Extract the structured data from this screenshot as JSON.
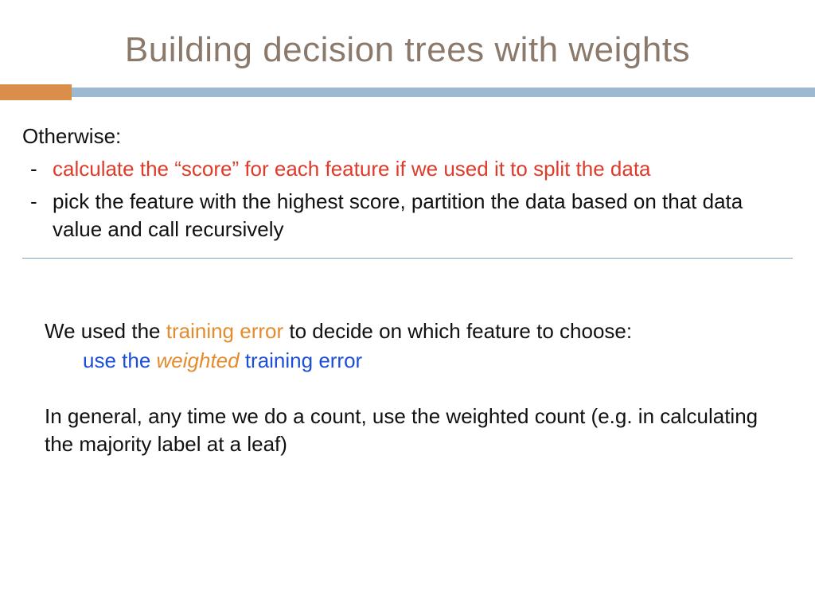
{
  "title": "Building decision trees with weights",
  "otherwise": "Otherwise:",
  "bullet1": "calculate the “score” for each feature if we used it to split the data",
  "bullet2": "pick the feature with the highest score, partition the data based on that data value and call recursively",
  "p1_a": "We used the ",
  "p1_b": "training error",
  "p1_c": " to decide on which feature to choose:",
  "p2_a": "use the ",
  "p2_b": "weighted",
  "p2_c": " training error",
  "p3": "In general, any time we do a count, use the weighted count (e.g. in calculating the majority label at a leaf)"
}
